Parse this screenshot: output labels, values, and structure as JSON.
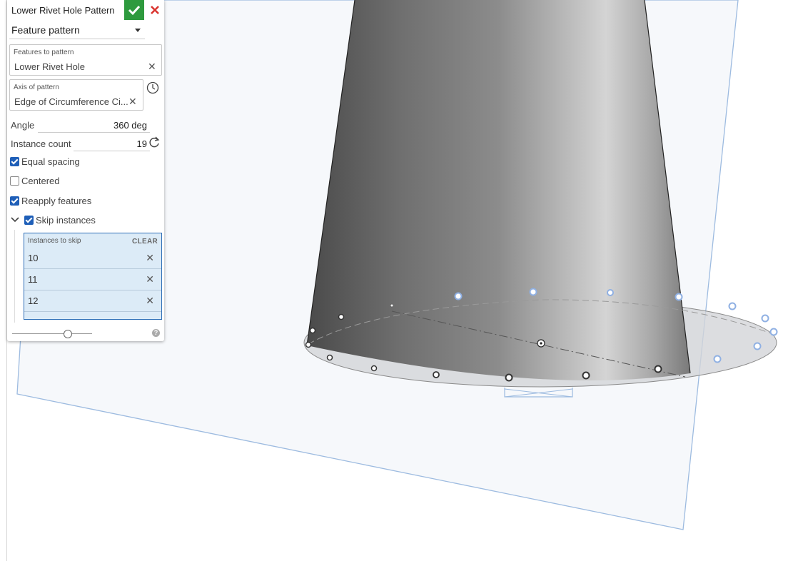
{
  "dialog": {
    "title": "Lower Rivet Hole Pattern",
    "pattern_type": "Feature pattern",
    "features_to_pattern": {
      "label": "Features to pattern",
      "value": "Lower Rivet Hole"
    },
    "axis_of_pattern": {
      "label": "Axis of pattern",
      "value": "Edge of Circumference Ci..."
    },
    "angle": {
      "label": "Angle",
      "value": "360 deg"
    },
    "instance_count": {
      "label": "Instance count",
      "value": "19"
    },
    "equal_spacing": {
      "label": "Equal spacing",
      "checked": true
    },
    "centered": {
      "label": "Centered",
      "checked": false
    },
    "reapply_features": {
      "label": "Reapply features",
      "checked": true
    },
    "skip_instances": {
      "label": "Skip instances",
      "checked": true
    },
    "instances_to_skip": {
      "label": "Instances to skip",
      "clear_label": "CLEAR",
      "items": [
        "10",
        "11",
        "12"
      ]
    },
    "help": "?"
  },
  "colors": {
    "accept": "#2e9a3e",
    "cancel": "#d9332e",
    "checkbox": "#1f5fb8",
    "selection_fill": "#dcebf7",
    "plane": "#8fb3d9"
  },
  "icons": {
    "accept": "check-icon",
    "cancel": "close-icon",
    "dropdown": "caret-down-icon",
    "history": "clock-icon",
    "refresh": "refresh-icon",
    "collapse": "chevron-down-icon",
    "help": "help-icon"
  }
}
